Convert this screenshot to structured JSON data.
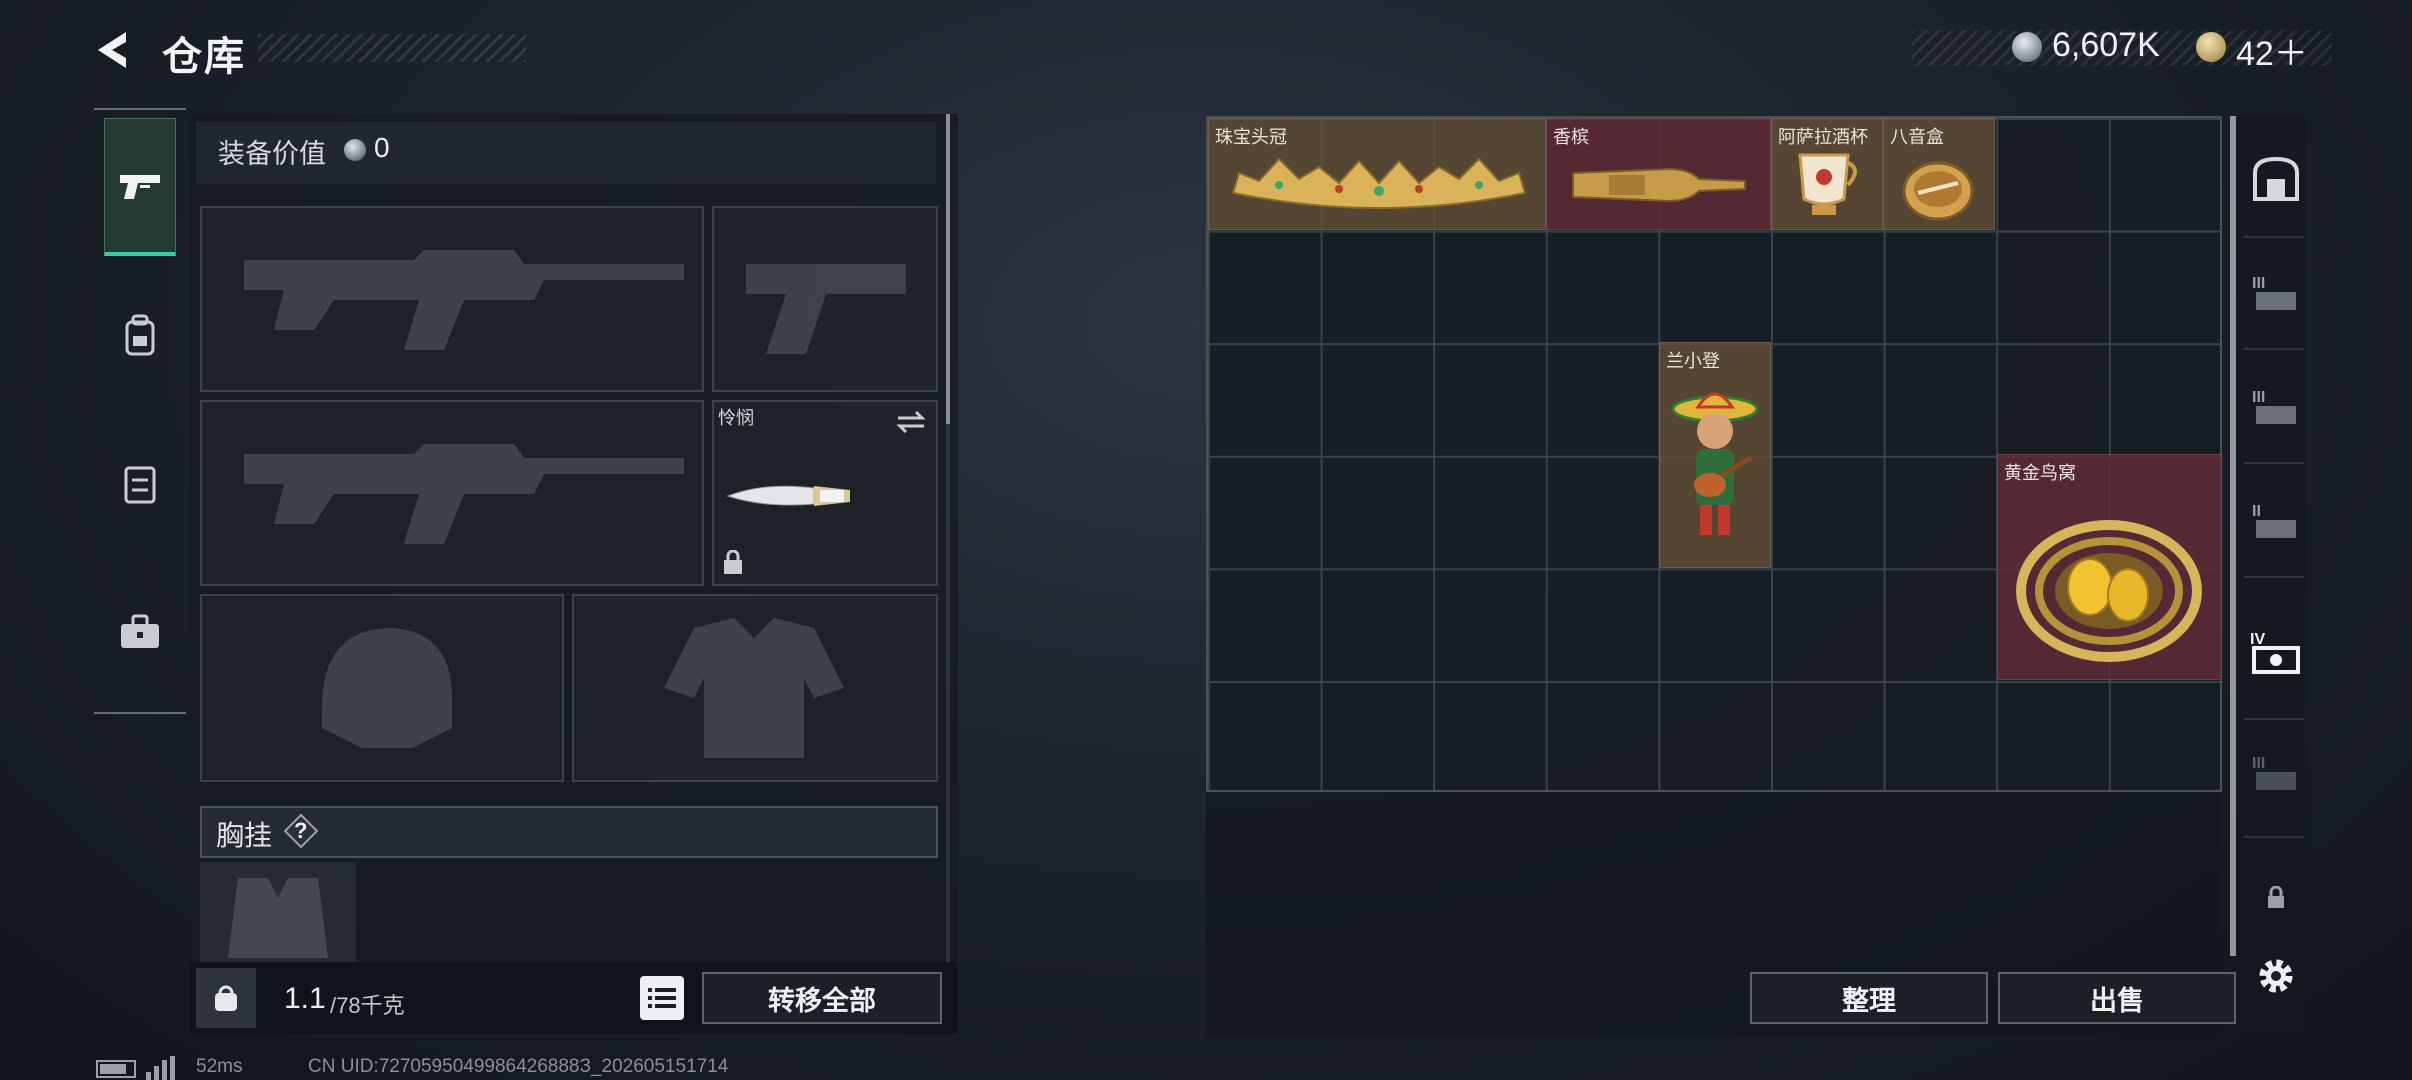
{
  "header": {
    "title": "仓库",
    "silver_amount": "6,607K",
    "gold_amount": "42＋"
  },
  "equipment": {
    "value_label": "装备价值",
    "value": "0",
    "knife_label": "怜悯",
    "chest_rig_label": "胸挂",
    "chest_rig_help": "?"
  },
  "weight": {
    "current": "1.1",
    "max": "/78千克"
  },
  "buttons": {
    "transfer_all": "转移全部",
    "organize": "整理",
    "sell": "出售"
  },
  "stash_items": [
    {
      "name": "珠宝头冠",
      "rarity": "gold"
    },
    {
      "name": "香槟",
      "rarity": "red"
    },
    {
      "name": "阿萨拉酒杯",
      "rarity": "gold"
    },
    {
      "name": "八音盒",
      "rarity": "gold"
    },
    {
      "name": "兰小登",
      "rarity": "gold"
    },
    {
      "name": "黄金鸟窝",
      "rarity": "red"
    }
  ],
  "right_tabs": [
    "backpack-icon",
    "chest-rig-tier-3-icon",
    "chest-rig-tier-3-icon",
    "chest-rig-tier-2-icon",
    "case-tier-4-icon",
    "case-tier-3-icon",
    "lock-icon",
    "gear-icon"
  ],
  "status": {
    "ping": "52ms",
    "uid": "CN UID:7270595049986426888З_202605151714"
  },
  "colors": {
    "accent": "#31d1a5",
    "gold_item": "#604e36",
    "red_item": "#602c36"
  }
}
